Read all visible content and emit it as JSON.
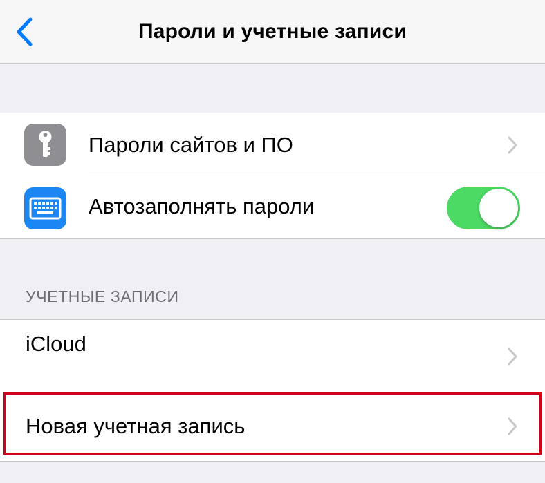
{
  "navbar": {
    "title": "Пароли и учетные записи",
    "back_icon": "chevron-left-icon"
  },
  "settings": {
    "items": [
      {
        "label": "Пароли сайтов и ПО",
        "icon": "key-icon",
        "icon_color": "#8e8e93",
        "accessory": "chevron-right-icon"
      },
      {
        "label": "Автозаполнять пароли",
        "icon": "keyboard-icon",
        "icon_color": "#1c87f2",
        "accessory": "toggle",
        "toggle_on": true,
        "toggle_color": "#4cd964"
      }
    ]
  },
  "accounts": {
    "header": "УЧЕТНЫЕ ЗАПИСИ",
    "items": [
      {
        "label": "iCloud",
        "accessory": "chevron-right-icon"
      },
      {
        "label": "Новая учетная запись",
        "accessory": "chevron-right-icon",
        "highlighted": true,
        "highlight_color": "#d0021b"
      }
    ]
  },
  "colors": {
    "accent": "#007aff",
    "background": "#efeff4"
  }
}
